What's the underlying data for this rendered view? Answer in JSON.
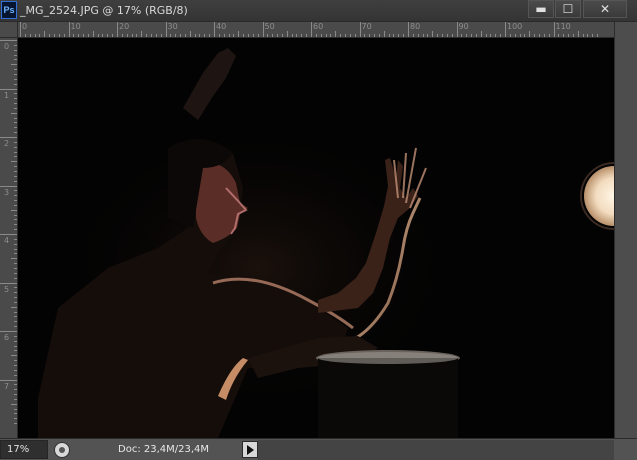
{
  "window": {
    "app_icon": "Ps",
    "title": "_MG_2524.JPG @ 17% (RGB/8)",
    "buttons": {
      "minimize": "minimize-icon",
      "maximize": "maximize-icon",
      "close": "close-icon"
    }
  },
  "rulers": {
    "horizontal_labels": [
      "0",
      "10",
      "20",
      "30",
      "40",
      "50",
      "60",
      "70",
      "80",
      "90",
      "100",
      "110"
    ],
    "vertical_labels": [
      "0",
      "1",
      "2",
      "3",
      "4",
      "5",
      "6",
      "7"
    ]
  },
  "canvas": {
    "image": "dark-photograph-woman-hand-raised-lamp",
    "background": "#030303"
  },
  "status": {
    "zoom": "17%",
    "doc_size": "Doc: 23,4M/23,4M"
  }
}
